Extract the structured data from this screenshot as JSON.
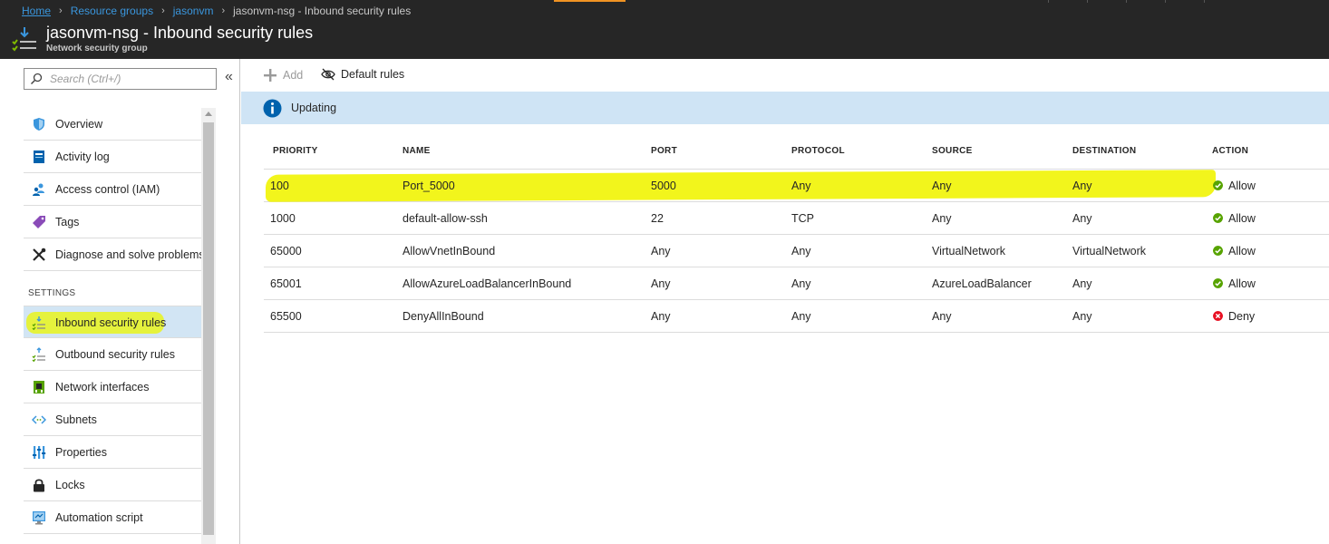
{
  "breadcrumb": {
    "home": "Home",
    "resource_groups": "Resource groups",
    "vm": "jasonvm",
    "current": "jasonvm-nsg - Inbound security rules"
  },
  "header": {
    "title": "jasonvm-nsg - Inbound security rules",
    "subtitle": "Network security group"
  },
  "search": {
    "placeholder": "Search (Ctrl+/)"
  },
  "sidebar": {
    "items": [
      {
        "label": "Overview",
        "icon": "shield-icon"
      },
      {
        "label": "Activity log",
        "icon": "activity-log-icon"
      },
      {
        "label": "Access control (IAM)",
        "icon": "users-icon"
      },
      {
        "label": "Tags",
        "icon": "tag-icon"
      },
      {
        "label": "Diagnose and solve problems",
        "icon": "wrench-icon"
      }
    ],
    "settings_label": "SETTINGS",
    "settings_items": [
      {
        "label": "Inbound security rules",
        "icon": "inbound-rules-icon",
        "selected": true
      },
      {
        "label": "Outbound security rules",
        "icon": "outbound-rules-icon"
      },
      {
        "label": "Network interfaces",
        "icon": "network-interface-icon"
      },
      {
        "label": "Subnets",
        "icon": "subnets-icon"
      },
      {
        "label": "Properties",
        "icon": "properties-icon"
      },
      {
        "label": "Locks",
        "icon": "lock-icon"
      },
      {
        "label": "Automation script",
        "icon": "automation-script-icon"
      }
    ]
  },
  "toolbar": {
    "add_label": "Add",
    "default_rules_label": "Default rules"
  },
  "banner": {
    "text": "Updating"
  },
  "table": {
    "headers": {
      "priority": "PRIORITY",
      "name": "NAME",
      "port": "PORT",
      "protocol": "PROTOCOL",
      "source": "SOURCE",
      "destination": "DESTINATION",
      "action": "ACTION"
    },
    "rows": [
      {
        "priority": "100",
        "name": "Port_5000",
        "port": "5000",
        "protocol": "Any",
        "source": "Any",
        "destination": "Any",
        "action": "Allow",
        "highlighted": true
      },
      {
        "priority": "1000",
        "name": "default-allow-ssh",
        "port": "22",
        "protocol": "TCP",
        "source": "Any",
        "destination": "Any",
        "action": "Allow"
      },
      {
        "priority": "65000",
        "name": "AllowVnetInBound",
        "port": "Any",
        "protocol": "Any",
        "source": "VirtualNetwork",
        "destination": "VirtualNetwork",
        "action": "Allow"
      },
      {
        "priority": "65001",
        "name": "AllowAzureLoadBalancerInBound",
        "port": "Any",
        "protocol": "Any",
        "source": "AzureLoadBalancer",
        "destination": "Any",
        "action": "Allow"
      },
      {
        "priority": "65500",
        "name": "DenyAllInBound",
        "port": "Any",
        "protocol": "Any",
        "source": "Any",
        "destination": "Any",
        "action": "Deny"
      }
    ]
  },
  "colors": {
    "header_bg": "#262626",
    "link": "#3a96dd",
    "accent": "#f09323",
    "allow": "#57a300",
    "deny": "#e81123",
    "info": "#0062ad",
    "highlight": "#f2f51c"
  }
}
